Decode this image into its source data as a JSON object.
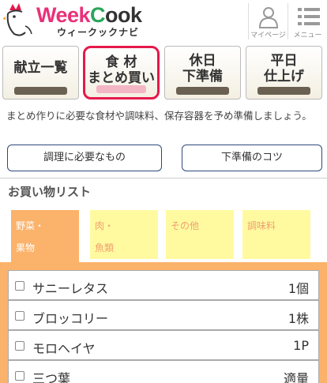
{
  "header": {
    "logo": {
      "part1": "Week",
      "part2": "C",
      "part3": "ook",
      "sub": "ウィークックナビ"
    },
    "mypage_label": "マイページ",
    "menu_label": "メニュー"
  },
  "tabs": [
    {
      "line1": "献立一覧",
      "line2": ""
    },
    {
      "line1": "食 材",
      "line2": "まとめ買い"
    },
    {
      "line1": "休日",
      "line2": "下準備"
    },
    {
      "line1": "平日",
      "line2": "仕上げ"
    }
  ],
  "description": "まとめ作りに必要な食材や調味料、保存容器を予め準備しましょう。",
  "sub_buttons": {
    "needed": "調理に必要なもの",
    "tips": "下準備のコツ"
  },
  "section_title": "お買い物リスト",
  "categories": [
    {
      "line1": "野菜・",
      "line2": "果物"
    },
    {
      "line1": "肉・",
      "line2": "魚類"
    },
    {
      "line1": "その他",
      "line2": ""
    },
    {
      "line1": "調味料",
      "line2": ""
    }
  ],
  "items": [
    {
      "name": "サニーレタス",
      "qty": "1個"
    },
    {
      "name": "ブロッコリー",
      "qty": "1株"
    },
    {
      "name": "モロヘイヤ",
      "qty": "1P"
    },
    {
      "name": "三つ葉",
      "qty": "適量"
    }
  ],
  "colors": {
    "accent_pink": "#e5194a",
    "category_active": "#fbb26a",
    "category_inactive": "#fffaa0",
    "logo_green": "#2aa55b"
  }
}
